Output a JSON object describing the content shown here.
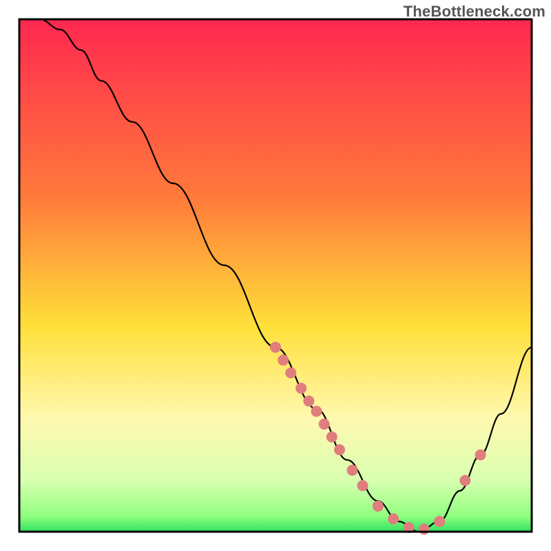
{
  "watermark": "TheBottleneck.com",
  "chart_data": {
    "type": "line",
    "title": "",
    "xlabel": "",
    "ylabel": "",
    "xlim": [
      0,
      100
    ],
    "ylim": [
      0,
      100
    ],
    "background_gradient_stops": [
      {
        "offset": 0.0,
        "color": "#ff2850"
      },
      {
        "offset": 0.35,
        "color": "#ff7b3a"
      },
      {
        "offset": 0.6,
        "color": "#ffe03a"
      },
      {
        "offset": 0.78,
        "color": "#fff8b0"
      },
      {
        "offset": 0.9,
        "color": "#d8ffb0"
      },
      {
        "offset": 0.97,
        "color": "#90ff80"
      },
      {
        "offset": 1.0,
        "color": "#30e060"
      }
    ],
    "series": [
      {
        "name": "bottleneck-curve",
        "x": [
          4.0,
          8.0,
          12.0,
          16.0,
          22.0,
          30.0,
          40.0,
          50.0,
          58.0,
          64.0,
          70.0,
          74.0,
          78.0,
          82.0,
          86.0,
          90.0,
          94.0,
          100.0
        ],
        "y": [
          100.0,
          98.0,
          94.0,
          88.0,
          80.0,
          68.0,
          52.0,
          36.0,
          24.0,
          14.0,
          6.0,
          2.0,
          0.0,
          2.0,
          8.0,
          15.0,
          23.0,
          36.0
        ],
        "color": "#000000",
        "weight": 2.2
      }
    ],
    "highlight_points": {
      "name": "marker-dots",
      "color": "#e07d7d",
      "radius": 8,
      "points": [
        {
          "x": 50.0,
          "y": 36.0
        },
        {
          "x": 51.5,
          "y": 33.5
        },
        {
          "x": 53.0,
          "y": 31.0
        },
        {
          "x": 55.0,
          "y": 28.0
        },
        {
          "x": 56.5,
          "y": 25.5
        },
        {
          "x": 58.0,
          "y": 23.5
        },
        {
          "x": 59.5,
          "y": 21.0
        },
        {
          "x": 61.0,
          "y": 18.5
        },
        {
          "x": 62.5,
          "y": 16.0
        },
        {
          "x": 65.0,
          "y": 12.0
        },
        {
          "x": 67.0,
          "y": 9.0
        },
        {
          "x": 70.0,
          "y": 5.0
        },
        {
          "x": 73.0,
          "y": 2.5
        },
        {
          "x": 76.0,
          "y": 0.8
        },
        {
          "x": 79.0,
          "y": 0.5
        },
        {
          "x": 82.0,
          "y": 2.0
        },
        {
          "x": 87.0,
          "y": 10.0
        },
        {
          "x": 90.0,
          "y": 15.0
        }
      ]
    }
  }
}
